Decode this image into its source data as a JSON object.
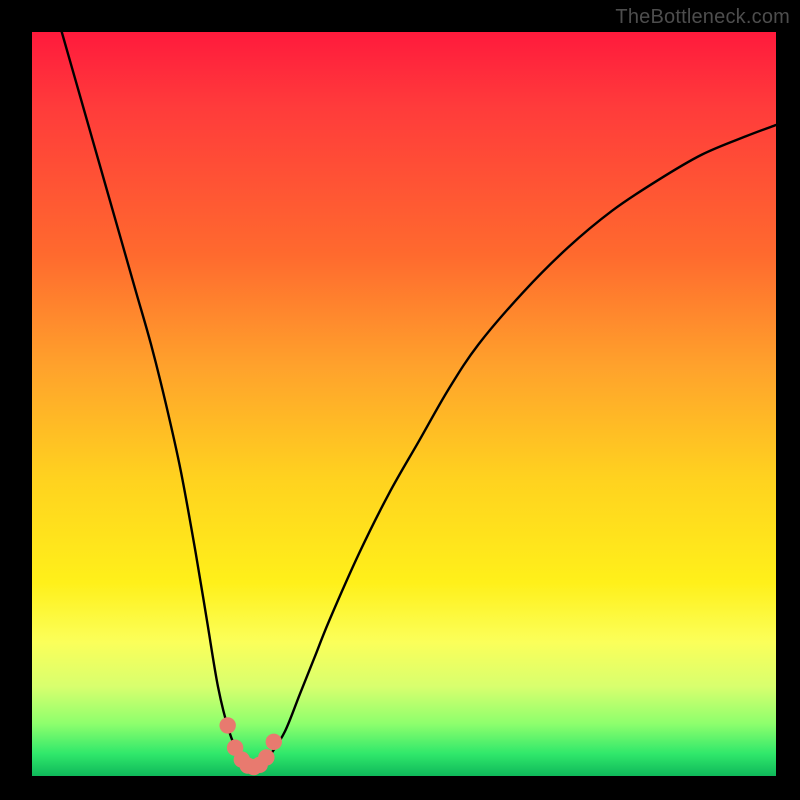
{
  "watermark": "TheBottleneck.com",
  "colors": {
    "frame": "#000000",
    "curve_stroke": "#000000",
    "marker_fill": "#e87a6f",
    "marker_stroke": "#c9564b"
  },
  "chart_data": {
    "type": "line",
    "title": "",
    "xlabel": "",
    "ylabel": "",
    "xlim": [
      0,
      100
    ],
    "ylim": [
      0,
      100
    ],
    "grid": false,
    "legend": false,
    "annotations": [],
    "series": [
      {
        "name": "bottleneck-curve",
        "x": [
          4,
          6,
          8,
          10,
          12,
          14,
          16,
          18,
          20,
          22,
          23.5,
          25,
          26.5,
          28,
          29,
          30,
          31,
          32,
          34,
          36,
          38,
          40,
          44,
          48,
          52,
          56,
          60,
          66,
          72,
          78,
          84,
          90,
          96,
          100
        ],
        "y": [
          100,
          93,
          86,
          79,
          72,
          65,
          58,
          50,
          41,
          30,
          21,
          12,
          6,
          2.5,
          1.5,
          1.2,
          1.5,
          2.8,
          6,
          11,
          16,
          21,
          30,
          38,
          45,
          52,
          58,
          65,
          71,
          76,
          80,
          83.5,
          86,
          87.5
        ]
      }
    ],
    "markers": {
      "name": "trough-dots",
      "x": [
        26.3,
        27.3,
        28.2,
        29.0,
        29.8,
        30.6,
        31.5,
        32.5
      ],
      "y": [
        6.8,
        3.8,
        2.2,
        1.4,
        1.2,
        1.5,
        2.5,
        4.6
      ]
    }
  }
}
